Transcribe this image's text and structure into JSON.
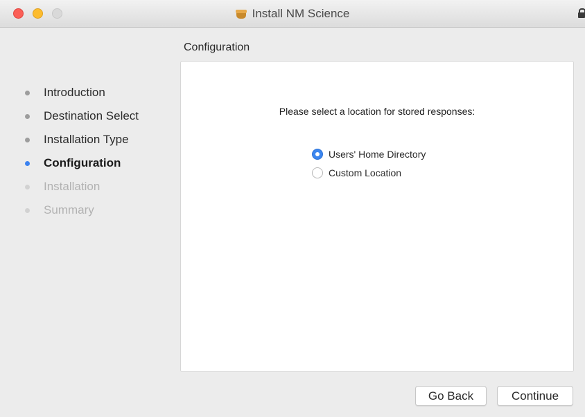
{
  "window": {
    "title": "Install NM Science",
    "app_icon": "package-installer-icon",
    "lock_icon": "lock-icon",
    "traffic_lights": {
      "close_color": "#fb5f57",
      "minimize_color": "#fdbc2e",
      "zoom_color": "#d9d9d9"
    }
  },
  "page": {
    "heading": "Configuration"
  },
  "sidebar": {
    "steps": [
      {
        "label": "Introduction",
        "state": "completed"
      },
      {
        "label": "Destination Select",
        "state": "completed"
      },
      {
        "label": "Installation Type",
        "state": "completed"
      },
      {
        "label": "Configuration",
        "state": "current"
      },
      {
        "label": "Installation",
        "state": "upcoming"
      },
      {
        "label": "Summary",
        "state": "upcoming"
      }
    ],
    "current_bullet_color": "#3b82f0"
  },
  "content": {
    "prompt": "Please select a location for stored responses:",
    "options": [
      {
        "label": "Users' Home Directory",
        "selected": true
      },
      {
        "label": "Custom Location",
        "selected": false
      }
    ],
    "accent_color": "#3b86ef"
  },
  "footer": {
    "back_label": "Go Back",
    "continue_label": "Continue"
  }
}
